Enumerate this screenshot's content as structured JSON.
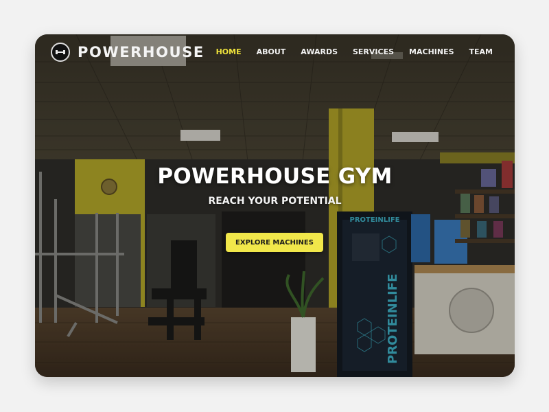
{
  "site": {
    "brand": "POWERHOUSE",
    "logo_icon": "dumbbell-icon"
  },
  "nav": {
    "items": [
      {
        "label": "HOME",
        "active": true
      },
      {
        "label": "ABOUT",
        "active": false
      },
      {
        "label": "AWARDS",
        "active": false
      },
      {
        "label": "SERVICES",
        "active": false
      },
      {
        "label": "MACHINES",
        "active": false
      },
      {
        "label": "TEAM",
        "active": false
      }
    ]
  },
  "hero": {
    "title": "POWERHOUSE GYM",
    "subtitle": "REACH YOUR POTENTIAL",
    "cta_label": "EXPLORE MACHINES",
    "vending_brand": "PROTEINLIFE"
  },
  "colors": {
    "accent": "#f1e74a",
    "accent_text": "#1a1a1a",
    "nav_active": "#f0e43c",
    "page_background": "#f2f2f2"
  }
}
